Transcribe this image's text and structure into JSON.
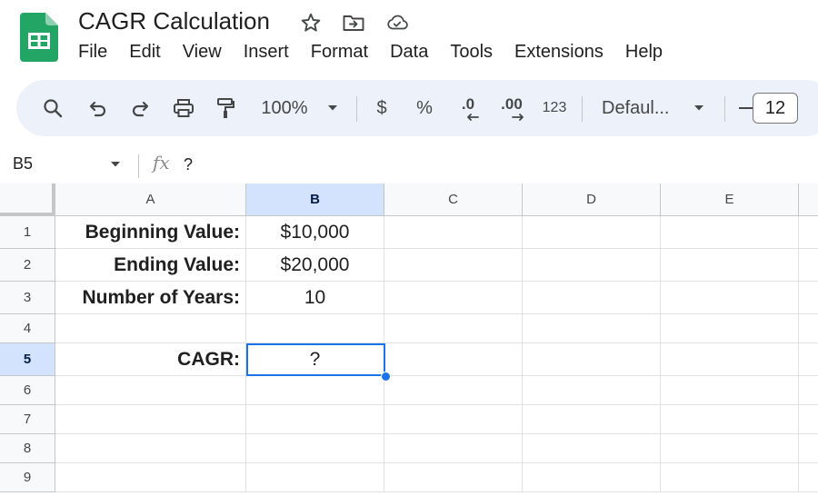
{
  "app": {
    "title": "CAGR Calculation"
  },
  "menu": [
    "File",
    "Edit",
    "View",
    "Insert",
    "Format",
    "Data",
    "Tools",
    "Extensions",
    "Help"
  ],
  "toolbar": {
    "zoom": "100%",
    "currency": "$",
    "percent": "%",
    "decrease_decimal": ".0",
    "increase_decimal": ".00",
    "more_formats": "123",
    "font": "Defaul...",
    "font_size": "12"
  },
  "formula_bar": {
    "name_box": "B5",
    "formula": "?"
  },
  "grid": {
    "columns": [
      "A",
      "B",
      "C",
      "D",
      "E"
    ],
    "active_column": "B",
    "rows": [
      "1",
      "2",
      "3",
      "4",
      "5",
      "6",
      "7",
      "8",
      "9"
    ],
    "active_row": "5",
    "cells": {
      "A1": "Beginning Value:",
      "B1": "$10,000",
      "A2": "Ending Value:",
      "B2": "$20,000",
      "A3": "Number of Years:",
      "B3": "10",
      "A5": "CAGR:",
      "B5": "?"
    }
  },
  "colors": {
    "accent": "#1a73e8",
    "toolbar_bg": "#edf2fa",
    "header_active": "#d3e3fd",
    "sheets_green": "#188038"
  }
}
